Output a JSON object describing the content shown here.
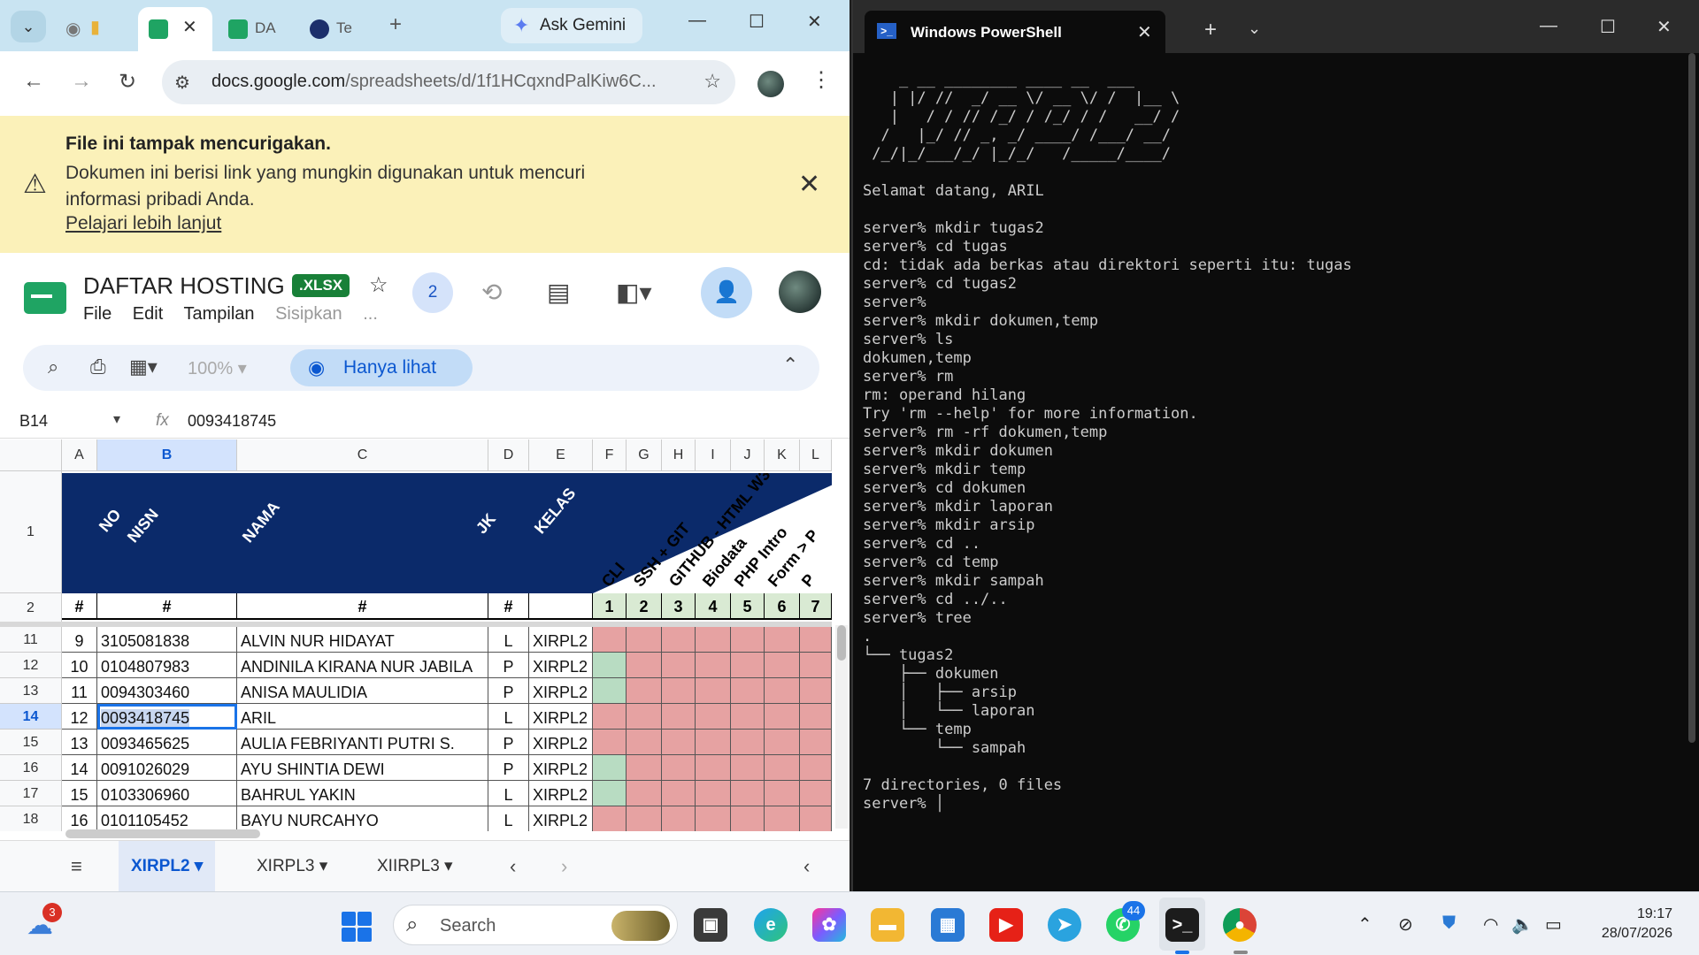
{
  "browser": {
    "tabs": [
      {
        "label": ""
      },
      {
        "label": "",
        "active": true
      },
      {
        "label": "DA"
      },
      {
        "label": "Te"
      }
    ],
    "gemini_label": "Ask Gemini",
    "url_host": "docs.google.com",
    "url_path": "/spreadsheets/d/1f1HCqxndPalKiw6C..."
  },
  "warning": {
    "title": "File ini tampak mencurigakan.",
    "body": "Dokumen ini berisi link yang mungkin digunakan untuk mencuri informasi pribadi Anda.",
    "link": "Pelajari lebih lanjut"
  },
  "sheets": {
    "title": "DAFTAR HOSTING",
    "badge": ".XLSX",
    "menu": [
      "File",
      "Edit",
      "Tampilan",
      "Sisipkan",
      "..."
    ],
    "collaborators": "2",
    "zoom": "100%",
    "view_only": "Hanya lihat",
    "cell_ref": "B14",
    "formula_value": "0093418745",
    "columns": [
      "A",
      "B",
      "C",
      "D",
      "E",
      "F",
      "G",
      "H",
      "I",
      "J",
      "K",
      "L"
    ],
    "header_labels": [
      "NO",
      "NISN",
      "NAMA",
      "JK",
      "KELAS",
      "CLI",
      "SSH + GIT",
      "GITHUB - HTML W3",
      "Biodata",
      "PHP Intro",
      "Form > P",
      "P"
    ],
    "row2": [
      "#",
      "#",
      "#",
      "#",
      "",
      "1",
      "2",
      "3",
      "4",
      "5",
      "6",
      "7"
    ],
    "row_numbers": [
      "1",
      "2",
      "11",
      "12",
      "13",
      "14",
      "15",
      "16",
      "17",
      "18"
    ],
    "rows": [
      {
        "no": "9",
        "nisn": "3105081838",
        "nama": "ALVIN NUR HIDAYAT",
        "jk": "L",
        "kelas": "XIRPL2",
        "f": "red"
      },
      {
        "no": "10",
        "nisn": "0104807983",
        "nama": "ANDINILA KIRANA NUR JABILA",
        "jk": "P",
        "kelas": "XIRPL2",
        "f": "green"
      },
      {
        "no": "11",
        "nisn": "0094303460",
        "nama": "ANISA MAULIDIA",
        "jk": "P",
        "kelas": "XIRPL2",
        "f": "green"
      },
      {
        "no": "12",
        "nisn": "0093418745",
        "nama": "ARIL",
        "jk": "L",
        "kelas": "XIRPL2",
        "f": "red"
      },
      {
        "no": "13",
        "nisn": "0093465625",
        "nama": "AULIA FEBRIYANTI PUTRI S.",
        "jk": "P",
        "kelas": "XIRPL2",
        "f": "red"
      },
      {
        "no": "14",
        "nisn": "0091026029",
        "nama": "AYU SHINTIA DEWI",
        "jk": "P",
        "kelas": "XIRPL2",
        "f": "green"
      },
      {
        "no": "15",
        "nisn": "0103306960",
        "nama": "BAHRUL YAKIN",
        "jk": "L",
        "kelas": "XIRPL2",
        "f": "green"
      },
      {
        "no": "16",
        "nisn": "0101105452",
        "nama": "BAYU NURCAHYO",
        "jk": "L",
        "kelas": "XIRPL2",
        "f": "red"
      }
    ],
    "sheet_tabs": [
      "XIRPL2",
      "XIRPL3",
      "XIIRPL3"
    ]
  },
  "powershell": {
    "title": "Windows PowerShell",
    "ascii_art": "    _ __ ________ ____ __  ___\n   | |/ //  _/ __ \\/ __ \\/ /  |__ \\\n   |   / / // /_/ / /_/ / /   __/ /\n  /   |_/ // _, _/ ____/ /___/ __/\n /_/|_/___/_/ |_/_/   /_____/____/",
    "lines": [
      "",
      "Selamat datang, ARIL",
      "",
      "server% mkdir tugas2",
      "server% cd tugas",
      "cd: tidak ada berkas atau direktori seperti itu: tugas",
      "server% cd tugas2",
      "server%",
      "server% mkdir dokumen,temp",
      "server% ls",
      "dokumen,temp",
      "server% rm",
      "rm: operand hilang",
      "Try 'rm --help' for more information.",
      "server% rm -rf dokumen,temp",
      "server% mkdir dokumen",
      "server% mkdir temp",
      "server% cd dokumen",
      "server% mkdir laporan",
      "server% mkdir arsip",
      "server% cd ..",
      "server% cd temp",
      "server% mkdir sampah",
      "server% cd ../..",
      "server% tree",
      ".",
      "└── tugas2",
      "    ├── dokumen",
      "    │   ├── arsip",
      "    │   └── laporan",
      "    └── temp",
      "        └── sampah",
      "",
      "7 directories, 0 files",
      "server% │"
    ]
  },
  "taskbar": {
    "weather_badge": "3",
    "search_placeholder": "Search",
    "whatsapp_badge": "44",
    "time": "19:17",
    "date": "28/07/2026"
  }
}
